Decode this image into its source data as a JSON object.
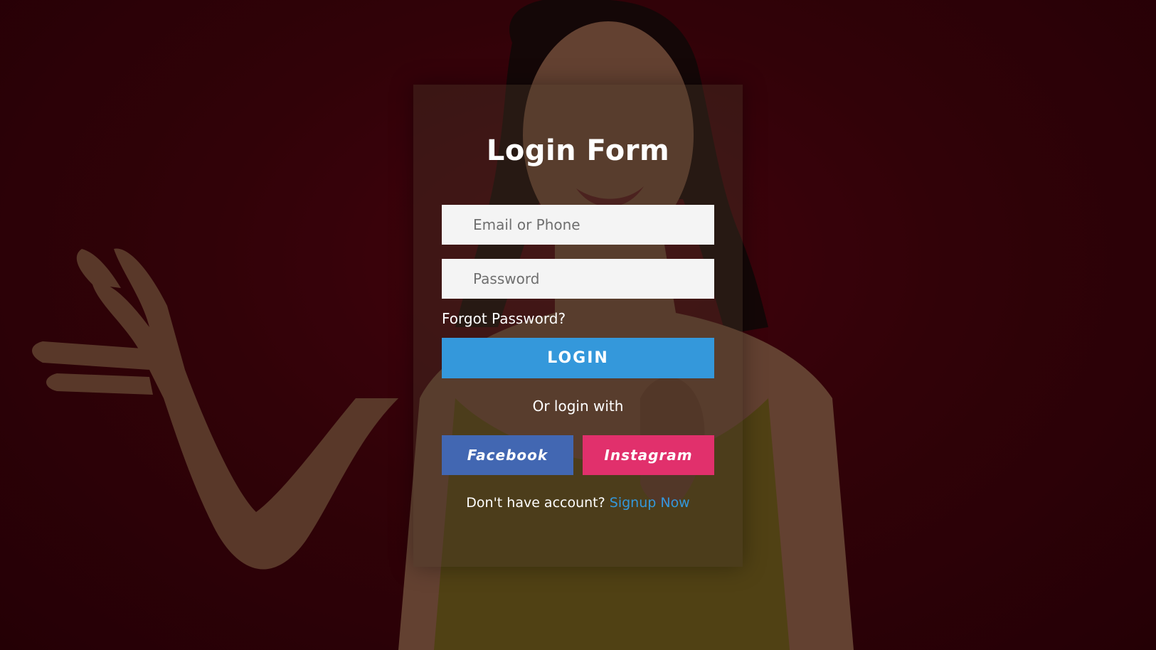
{
  "form": {
    "title": "Login Form",
    "email_placeholder": "Email or Phone",
    "password_placeholder": "Password",
    "forgot_link": "Forgot Password?",
    "login_button": "LOGIN",
    "or_text": "Or login with",
    "facebook_button": "Facebook",
    "instagram_button": "Instagram",
    "signup_prompt": "Don't have account?",
    "signup_link": "Signup Now"
  },
  "colors": {
    "background": "#3a0208",
    "login_button": "#3498db",
    "facebook": "#4267b2",
    "instagram": "#e1306c",
    "link": "#3498db"
  }
}
